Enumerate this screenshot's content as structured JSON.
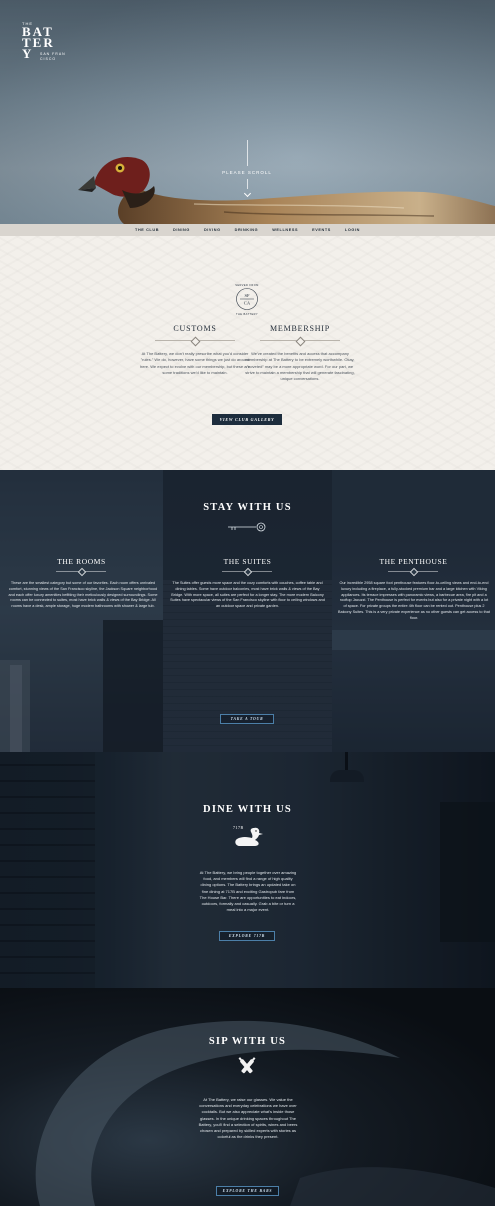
{
  "hero": {
    "logo": {
      "the": "THE",
      "line1": "BAT",
      "line2": "TER",
      "line3": "Y",
      "sub1": "SAN FRAN",
      "sub2": "CISCO"
    },
    "scroll_label": "PLEASE SCROLL"
  },
  "nav": {
    "items": [
      "THE CLUB",
      "DINING",
      "DIVING",
      "DRINKING",
      "WELLNESS",
      "EVENTS",
      "LOGIN"
    ]
  },
  "about": {
    "seal": {
      "top": "SERVED FROM",
      "mid": "SF",
      "mid2": "CA",
      "bottom": "THE BATTERY"
    },
    "customs": {
      "title": "CUSTOMS",
      "text": "At The Battery, we don't really prescribe what you'd consider \"rules.\" We do, however, have some things we just do around here. We expect to evolve with our membership, but these are some traditions we'd like to maintain."
    },
    "membership": {
      "title": "MEMBERSHIP",
      "text": "We've created the benefits and access that accompany membership at The Battery to be extremely worthwhile. Okay, \"coveted\" may be a more appropriate word. For our part, we strive to maintain a membership that will generate fascinating, unique conversations."
    },
    "button": "VIEW CLUB GALLERY"
  },
  "stay": {
    "title": "STAY WITH US",
    "rooms": {
      "title": "THE ROOMS",
      "text": "These are the smallest category but some of our favorites. Each room offers unrivaled comfort, stunning views of the San Francisco skyline, the Jackson Square neighborhood and each offer luxury amenities befitting their meticulously designed surroundings. Some rooms can be connected to suites, most have brick walls & views of the Bay Bridge. All rooms have a desk, ample storage, huge modern bathrooms with shower & large tub."
    },
    "suites": {
      "title": "THE SUITES",
      "text": "The Suites offer guests more space and the cozy comforts with couches, coffee table and dining tables. Some have outdoor balconies, most have brick walls & views of the Bay Bridge. With more space, all suites are perfect for a longer stay. The more modern Balcony Suites have spectacular views of the San Francisco skyline with floor to ceiling windows and an outdoor space and private garden."
    },
    "penthouse": {
      "title": "THE PENTHOUSE",
      "text": "Our incredible 2958 square foot penthouse features floor-to-ceiling views and end-to-end luxury including a fireplace, a fully-stocked premium bar and a large kitchen with Viking appliances. Its terrace impresses with panoramic views, a barbecue area, fire pit and a rooftop Jacuzzi. The Penthouse is perfect for events but also for a private night with a lot of space. For private groups the entire 4th floor can be rented out. Penthouse plus 2 Balcony Suites. This is a very private experience as no other guests can get access to that floor."
    },
    "button": "TAKE A TOUR"
  },
  "dine": {
    "title": "DINE WITH US",
    "badge": "717B",
    "text": "At The Battery, we bring people together over amazing food, and members will find a range of high quality dining options. The Battery brings an updated take on fine dining at 717B and exciting Gastropub fare from The House Bar. There are opportunities to eat indoors, outdoors, formally and casually. Grab a bite or turn a meal into a major event.",
    "button": "EXPLORE 717B"
  },
  "sip": {
    "title": "SIP WITH US",
    "text": "At The Battery, we raise our glasses. We value the conversations and everyday celebrations we have over cocktails. But we also appreciate what's inside those glasses. In the unique drinking spaces throughout The Battery, you'll find a selection of spirits, wines and beers chosen and prepared by skilled experts with stories as colorful as the drinks they present.",
    "button": "EXPLORE THE BARS"
  },
  "colors": {
    "navy": "#1d2d3d",
    "accent_blue": "#4c7fa8",
    "paper": "#f3f0eb"
  }
}
